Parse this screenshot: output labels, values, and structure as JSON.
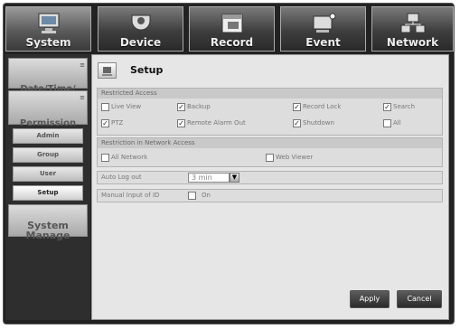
{
  "tabs": [
    {
      "label": "System",
      "icon": "system-icon"
    },
    {
      "label": "Device",
      "icon": "device-icon"
    },
    {
      "label": "Record",
      "icon": "record-icon"
    },
    {
      "label": "Event",
      "icon": "event-icon"
    },
    {
      "label": "Network",
      "icon": "network-icon"
    }
  ],
  "sidebar": {
    "date_time": "Date/Time/\nLanguage",
    "permission": "Permission\nManage",
    "items": [
      "Admin",
      "Group",
      "User",
      "Setup"
    ],
    "system_manage": "System\nManage"
  },
  "page": {
    "title": "Setup"
  },
  "restricted_access": {
    "header": "Restricted Access",
    "items": [
      {
        "label": "Live View",
        "checked": false
      },
      {
        "label": "Backup",
        "checked": true
      },
      {
        "label": "Record Lock",
        "checked": true
      },
      {
        "label": "Search",
        "checked": true
      },
      {
        "label": "PTZ",
        "checked": true
      },
      {
        "label": "Remote Alarm Out",
        "checked": true
      },
      {
        "label": "Shutdown",
        "checked": true
      },
      {
        "label": "All",
        "checked": false
      }
    ]
  },
  "network_restriction": {
    "header": "Restriction in Network Access",
    "items": [
      {
        "label": "All Network",
        "checked": false
      },
      {
        "label": "Web Viewer",
        "checked": false
      }
    ]
  },
  "auto_log_out": {
    "label": "Auto Log out",
    "value": "3 min"
  },
  "manual_id": {
    "label": "Manual Input of ID",
    "option": "On",
    "checked": false
  },
  "buttons": {
    "apply": "Apply",
    "cancel": "Cancel"
  },
  "colors": {
    "frame": "#222222",
    "panel": "#e6e6e6",
    "accent": "#3a3a3a"
  }
}
